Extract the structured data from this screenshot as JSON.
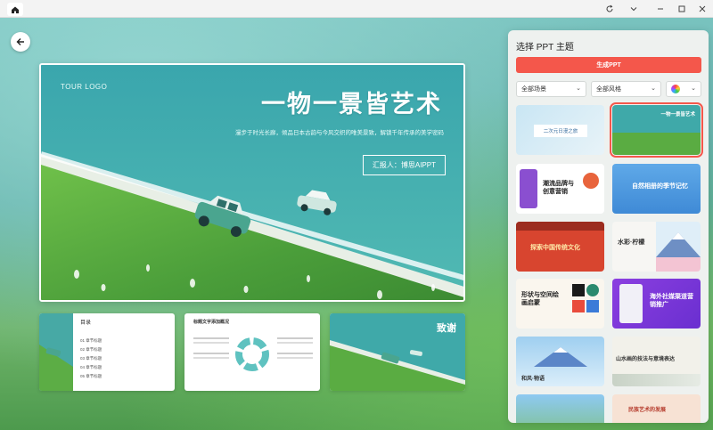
{
  "main_slide": {
    "logo": "TOUR LOGO",
    "title": "一物一景皆艺术",
    "subtitle": "漫步于时光长廊，倾品日本古韵与今风交织的唯美景致，解锁千年传承的美学密码",
    "reporter": "汇报人：博思AIPPT"
  },
  "thumbnails": {
    "toc_title": "目录",
    "toc_items": [
      "01 章节标题",
      "02 章节标题",
      "03 章节标题",
      "04 章节标题",
      "05 章节标题"
    ],
    "second_title": "标题文字添加概况",
    "thanks": "致谢"
  },
  "panel": {
    "title": "选择 PPT 主题",
    "generate": "生成PPT",
    "scene_select": "全部场景",
    "style_select": "全部风格"
  },
  "templates": [
    {
      "label": "二次元日漫之旅"
    },
    {
      "label": "一物一景皆艺术"
    },
    {
      "label": "潮流品牌与创意营销"
    },
    {
      "label": "自然相册的季节记忆"
    },
    {
      "label": "探索中国传统文化"
    },
    {
      "label": "水彩·柠檬"
    },
    {
      "label": "形状与空间绘画启蒙"
    },
    {
      "label": "海外社媒渠道营销推广"
    },
    {
      "label": "和风·物语"
    },
    {
      "label": "山水画的技法与意境表达"
    },
    {
      "label": ""
    },
    {
      "label": "民族艺术的发展"
    }
  ]
}
